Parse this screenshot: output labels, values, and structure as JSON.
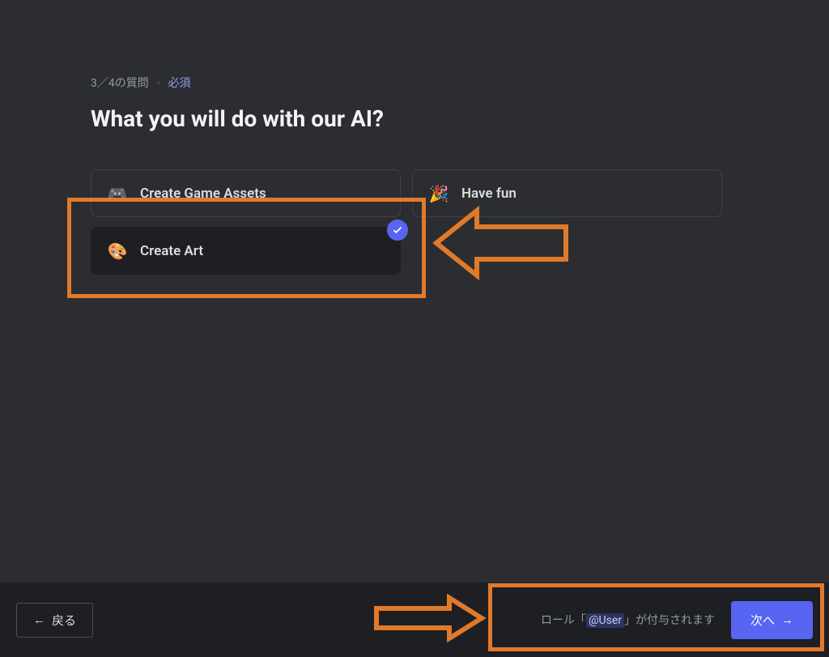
{
  "progress": {
    "step_text": "3／4の質問",
    "required_label": "必須"
  },
  "title": "What you will do with our AI?",
  "options": [
    {
      "icon": "🎮",
      "label": "Create Game Assets",
      "selected": false
    },
    {
      "icon": "🎉",
      "label": "Have fun",
      "selected": false
    },
    {
      "icon": "🎨",
      "label": "Create Art",
      "selected": true
    }
  ],
  "footer": {
    "back_label": "戻る",
    "role_prefix": "ロール「",
    "role_mention": "@User",
    "role_suffix": "」が付与されます",
    "next_label": "次へ"
  }
}
